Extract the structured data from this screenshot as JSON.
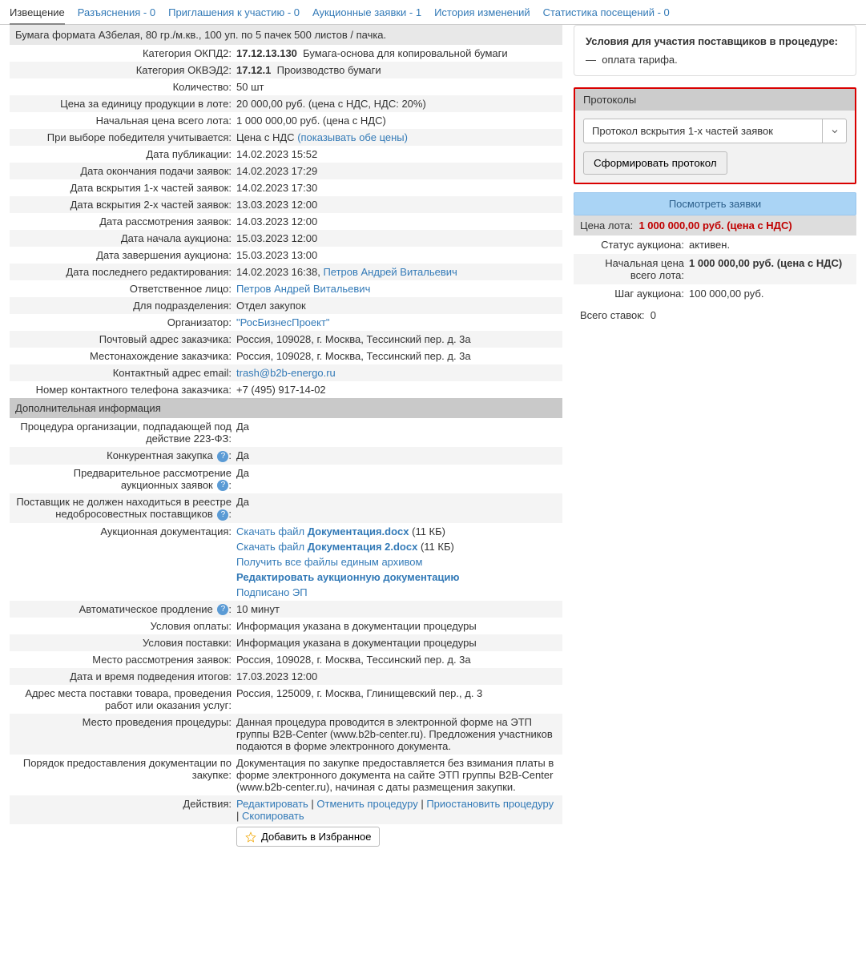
{
  "tabs": [
    {
      "label": "Извещение",
      "active": true
    },
    {
      "label": "Разъяснения - 0"
    },
    {
      "label": "Приглашения к участию - 0"
    },
    {
      "label": "Аукционные заявки - 1"
    },
    {
      "label": "История изменений"
    },
    {
      "label": "Статистика посещений - 0"
    }
  ],
  "lot_title": "Бумага формата А3белая, 80 гр./м.кв., 100 уп. по 5 пачек 500 листов / пачка.",
  "rows": {
    "okpd2_label": "Категория ОКПД2:",
    "okpd2_code": "17.12.13.130",
    "okpd2_desc": "Бумага-основа для копировальной бумаги",
    "okved2_label": "Категория ОКВЭД2:",
    "okved2_code": "17.12.1",
    "okved2_desc": "Производство бумаги",
    "qty_label": "Количество:",
    "qty_val": "50 шт",
    "unit_price_label": "Цена за единицу продукции в лоте:",
    "unit_price_val": "20 000,00 руб. (цена с НДС, НДС: 20%)",
    "start_price_label": "Начальная цена всего лота:",
    "start_price_val": "1 000 000,00 руб. (цена с НДС)",
    "winsel_label": "При выборе победителя учитывается:",
    "winsel_val": "Цена с НДС",
    "winsel_link": "(показывать обе цены)",
    "pub_date_label": "Дата публикации:",
    "pub_date_val": "14.02.2023 15:52",
    "end_submit_label": "Дата окончания подачи заявок:",
    "end_submit_val": "14.02.2023 17:29",
    "open1_label": "Дата вскрытия 1-х частей заявок:",
    "open1_val": "14.02.2023 17:30",
    "open2_label": "Дата вскрытия 2-х частей заявок:",
    "open2_val": "13.03.2023 12:00",
    "review_label": "Дата рассмотрения заявок:",
    "review_val": "14.03.2023 12:00",
    "auc_start_label": "Дата начала аукциона:",
    "auc_start_val": "15.03.2023 12:00",
    "auc_end_label": "Дата завершения аукциона:",
    "auc_end_val": "15.03.2023 13:00",
    "last_edit_label": "Дата последнего редактирования:",
    "last_edit_val": "14.02.2023 16:38, ",
    "last_edit_person": "Петров Андрей Витальевич",
    "resp_label": "Ответственное лицо:",
    "resp_val": "Петров Андрей Витальевич",
    "dept_label": "Для подразделения:",
    "dept_val": "Отдел закупок",
    "org_label": "Организатор:",
    "org_val": "\"РосБизнесПроект\"",
    "postaddr_label": "Почтовый адрес заказчика:",
    "postaddr_val": "Россия, 109028, г. Москва, Тессинский пер. д. 3а",
    "locaddr_label": "Местонахождение заказчика:",
    "locaddr_val": "Россия, 109028, г. Москва, Тессинский пер. д. 3а",
    "email_label": "Контактный адрес email:",
    "email_val": "trash@b2b-energo.ru",
    "phone_label": "Номер контактного телефона заказчика:",
    "phone_val": "+7 (495) 917-14-02"
  },
  "extra_header": "Дополнительная информация",
  "extra": {
    "fz223_label": "Процедура организации, подпадающей под действие 223-ФЗ:",
    "fz223_val": "Да",
    "comp_label": "Конкурентная закупка",
    "comp_val": "Да",
    "preview_label": "Предварительное рассмотрение аукционных заявок",
    "preview_val": "Да",
    "badsup_label": "Поставщик не должен находиться в реестре недобросовестных поставщиков",
    "badsup_val": "Да",
    "docs_label": "Аукционная документация:",
    "docs_dl_prefix": "Скачать файл ",
    "doc1_name": "Документация.docx",
    "doc1_size": " (11 КБ)",
    "doc2_name": "Документация 2.docx",
    "doc2_size": " (11 КБ)",
    "docs_all": "Получить все файлы единым архивом",
    "docs_edit": "Редактировать аукционную документацию",
    "docs_signed": "Подписано ЭП",
    "autoext_label": "Автоматическое продление",
    "autoext_val": "10 минут",
    "payterms_label": "Условия оплаты:",
    "payterms_val": "Информация указана в документации процедуры",
    "delterms_label": "Условия поставки:",
    "delterms_val": "Информация указана в документации процедуры",
    "revplace_label": "Место рассмотрения заявок:",
    "revplace_val": "Россия, 109028, г. Москва, Тессинский пер. д. 3а",
    "sumup_label": "Дата и время подведения итогов:",
    "sumup_val": "17.03.2023 12:00",
    "deladdr_label": "Адрес места поставки товара, проведения работ или оказания услуг:",
    "deladdr_val": "Россия, 125009, г. Москва, Глинищевский пер., д. 3",
    "procplace_label": "Место проведения процедуры:",
    "procplace_val": "Данная процедура проводится в электронной форме на ЭТП группы B2B-Center (www.b2b-center.ru). Предложения участников подаются в форме электронного документа.",
    "docorder_label": "Порядок предоставления документации по закупке:",
    "docorder_val": "Документация по закупке предоставляется без взимания платы в форме электронного документа на сайте ЭТП группы B2B-Center (www.b2b-center.ru), начиная с даты размещения закупки.",
    "actions_label": "Действия:",
    "act_edit": "Редактировать",
    "act_cancel": "Отменить процедуру",
    "act_pause": "Приостановить процедуру",
    "act_copy": "Скопировать",
    "sep": " | ",
    "fav_btn": "Добавить в Избранное"
  },
  "side": {
    "cond_title": "Условия для участия поставщиков в процедуре:",
    "cond_item": "оплата тарифа.",
    "proto_header": "Протоколы",
    "proto_select": "Протокол вскрытия 1-х частей заявок",
    "proto_btn": "Сформировать протокол",
    "view_bids": "Посмотреть заявки",
    "price_label": "Цена лота:",
    "price_val": "1 000 000,00 руб. (цена с НДС)",
    "status_label": "Статус аукциона:",
    "status_val": "активен.",
    "start_total_label": "Начальная цена всего лота:",
    "start_total_val": "1 000 000,00 руб. (цена с НДС)",
    "step_label": "Шаг аукциона:",
    "step_val": "100 000,00 руб.",
    "bids_total_label": "Всего ставок:",
    "bids_total_val": "0"
  }
}
